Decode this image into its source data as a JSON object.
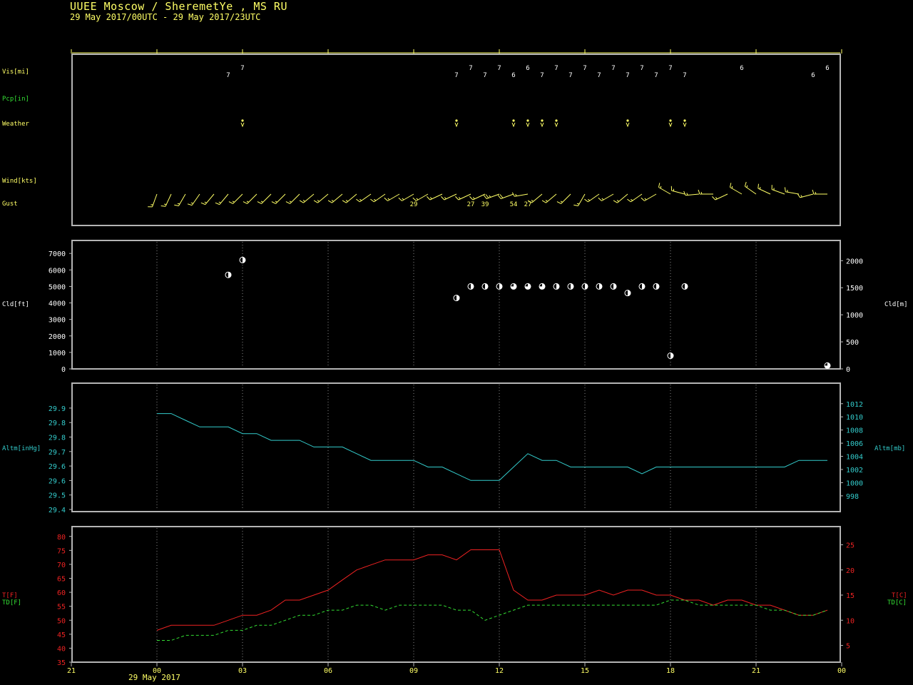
{
  "header": {
    "station": "UUEE  Moscow / SheremetYe , MS RU",
    "period": "29 May 2017/00UTC - 29 May 2017/23UTC"
  },
  "colors": {
    "frame": "#b4b4b4",
    "grid": "#8a8a8a",
    "yellow": "#ffff66",
    "green": "#33dd33",
    "cyan": "#33cccc",
    "red": "#ee2222",
    "white": "#ffffff"
  },
  "panel1": {
    "row_labels": {
      "vis": "Vis[mi]",
      "pcp": "Pcp[in]",
      "weather": "Weather",
      "wind": "Wind[kts]",
      "gust": "Gust"
    },
    "weather_icon": "drizzle-icon"
  },
  "panel2": {
    "left_label": "Cld[ft]",
    "right_label": "Cld[m]"
  },
  "panel3": {
    "left_label": "Altm[inHg]",
    "right_label": "Altm[mb]"
  },
  "panel4": {
    "left_label_t": "T[F]",
    "left_label_td": "TD[F]",
    "right_label_t": "T[C]",
    "right_label_td": "TD[C]"
  },
  "time_axis": {
    "date_label": "29 May 2017",
    "ticks": [
      "21",
      "00",
      "03",
      "06",
      "09",
      "12",
      "15",
      "18",
      "21",
      "00"
    ]
  },
  "chart_data": [
    {
      "type": "table",
      "name": "Vis[mi]",
      "x": [
        2.5,
        3.0,
        10.5,
        11.0,
        11.5,
        12.0,
        12.5,
        13.0,
        13.5,
        14.0,
        14.5,
        15.0,
        15.5,
        16.0,
        16.5,
        17.0,
        17.5,
        18.0,
        18.5,
        20.5,
        23.0,
        23.5
      ],
      "labels": [
        "7",
        "7",
        "7",
        "7",
        "7",
        "7",
        "6",
        "6",
        "7",
        "7",
        "7",
        "7",
        "7",
        "7",
        "7",
        "7",
        "7",
        "7",
        "7",
        "6",
        "6",
        "6"
      ]
    },
    {
      "type": "table",
      "name": "Weather",
      "x": [
        3.0,
        10.5,
        12.5,
        13.0,
        13.5,
        14.0,
        16.5,
        18.0,
        18.5
      ],
      "labels": [
        "drizzle",
        "drizzle",
        "drizzle",
        "drizzle",
        "drizzle",
        "drizzle",
        "drizzle",
        "drizzle",
        "drizzle"
      ]
    },
    {
      "type": "scatter",
      "name": "Wind[kts]",
      "x": [
        0.0,
        0.5,
        1.0,
        1.5,
        2.0,
        2.5,
        3.0,
        3.5,
        4.0,
        4.5,
        5.0,
        5.5,
        6.0,
        6.5,
        7.0,
        7.5,
        8.0,
        8.5,
        9.0,
        9.5,
        10.0,
        10.5,
        11.0,
        11.5,
        12.0,
        12.5,
        13.0,
        13.5,
        14.0,
        14.5,
        15.0,
        15.5,
        16.0,
        16.5,
        17.0,
        17.5,
        18.0,
        18.5,
        19.0,
        19.5,
        20.0,
        20.5,
        21.0,
        21.5,
        22.0,
        22.5,
        23.0,
        23.5
      ],
      "dir_deg": [
        200,
        205,
        210,
        215,
        220,
        220,
        225,
        225,
        225,
        225,
        225,
        230,
        230,
        230,
        230,
        235,
        235,
        240,
        240,
        240,
        245,
        245,
        245,
        245,
        250,
        250,
        260,
        230,
        230,
        225,
        210,
        235,
        240,
        230,
        235,
        240,
        300,
        285,
        265,
        270,
        245,
        300,
        305,
        295,
        290,
        280,
        255,
        270
      ],
      "speed_kts": [
        15,
        15,
        15,
        15,
        15,
        15,
        15,
        15,
        15,
        15,
        15,
        15,
        15,
        15,
        15,
        15,
        15,
        15,
        15,
        15,
        15,
        15,
        15,
        15,
        25,
        20,
        15,
        15,
        15,
        15,
        15,
        15,
        15,
        15,
        15,
        15,
        15,
        15,
        15,
        15,
        15,
        15,
        15,
        15,
        15,
        15,
        15,
        15
      ]
    },
    {
      "type": "table",
      "name": "Gust",
      "x": [
        9.0,
        11.0,
        11.5,
        12.5,
        13.0
      ],
      "labels": [
        "29",
        "27",
        "39",
        "54",
        "27"
      ]
    },
    {
      "type": "scatter",
      "title": "",
      "ylabel": "Cld[ft]",
      "ylabel_right": "Cld[m]",
      "ylim": [
        0,
        7700
      ],
      "yticks": [
        0,
        1000,
        2000,
        3000,
        4000,
        5000,
        6000,
        7000
      ],
      "yticks_right": [
        0,
        500,
        1000,
        1500,
        2000
      ],
      "x": [
        2.5,
        3.0,
        10.5,
        11.0,
        11.5,
        12.0,
        12.5,
        13.0,
        13.5,
        14.0,
        14.5,
        15.0,
        15.5,
        16.0,
        16.5,
        17.0,
        17.5,
        18.0,
        18.5,
        23.5
      ],
      "y": [
        5700,
        6600,
        4300,
        5000,
        5000,
        5000,
        5000,
        5000,
        5000,
        5000,
        5000,
        5000,
        5000,
        5000,
        4600,
        5000,
        5000,
        800,
        5000,
        200
      ],
      "cover": [
        "sct",
        "sct",
        "sct",
        "sct",
        "sct",
        "sct",
        "bkn",
        "bkn",
        "bkn",
        "sct",
        "sct",
        "sct",
        "sct",
        "sct",
        "sct",
        "sct",
        "sct",
        "sct",
        "sct",
        "bkn"
      ]
    },
    {
      "type": "line",
      "ylabel": "Altm[inHg]",
      "ylabel_right": "Altm[mb]",
      "ylim": [
        29.4,
        29.97
      ],
      "yticks": [
        29.4,
        29.5,
        29.6,
        29.6,
        29.7,
        29.8,
        29.8,
        29.9
      ],
      "yticks_right": [
        998,
        1000,
        1002,
        1004,
        1006,
        1008,
        1010,
        1012
      ],
      "x": [
        0.0,
        0.5,
        1.0,
        1.5,
        2.0,
        2.5,
        3.0,
        3.5,
        4.0,
        4.5,
        5.0,
        5.5,
        6.0,
        6.5,
        7.0,
        7.5,
        8.0,
        8.5,
        9.0,
        9.5,
        10.0,
        10.5,
        11.0,
        11.5,
        12.0,
        12.5,
        13.0,
        13.5,
        14.0,
        14.5,
        15.0,
        15.5,
        16.0,
        16.5,
        17.0,
        17.5,
        18.0,
        18.5,
        19.0,
        19.5,
        20.0,
        20.5,
        21.0,
        21.5,
        22.0,
        22.5,
        23.0,
        23.5
      ],
      "y": [
        29.84,
        29.84,
        29.81,
        29.78,
        29.78,
        29.78,
        29.75,
        29.75,
        29.72,
        29.72,
        29.72,
        29.69,
        29.69,
        29.69,
        29.66,
        29.63,
        29.63,
        29.63,
        29.63,
        29.6,
        29.6,
        29.57,
        29.54,
        29.54,
        29.54,
        29.6,
        29.66,
        29.63,
        29.63,
        29.6,
        29.6,
        29.6,
        29.6,
        29.6,
        29.57,
        29.6,
        29.6,
        29.6,
        29.6,
        29.6,
        29.6,
        29.6,
        29.6,
        29.6,
        29.6,
        29.63,
        29.63,
        29.63
      ]
    },
    {
      "type": "line",
      "ylabel": "T[F]",
      "ylabel_right": "T[C]",
      "ylim": [
        35,
        83
      ],
      "yticks": [
        35,
        40,
        45,
        50,
        55,
        60,
        65,
        70,
        75,
        80
      ],
      "yticks_right": [
        5,
        10,
        15,
        20,
        25
      ],
      "x": [
        0.0,
        0.5,
        1.0,
        1.5,
        2.0,
        2.5,
        3.0,
        3.5,
        4.0,
        4.5,
        5.0,
        5.5,
        6.0,
        6.5,
        7.0,
        7.5,
        8.0,
        8.5,
        9.0,
        9.5,
        10.0,
        10.5,
        11.0,
        11.5,
        12.0,
        12.5,
        13.0,
        13.5,
        14.0,
        14.5,
        15.0,
        15.5,
        16.0,
        16.5,
        17.0,
        17.5,
        18.0,
        18.5,
        19.0,
        19.5,
        20.0,
        20.5,
        21.0,
        21.5,
        22.0,
        22.5,
        23.0,
        23.5
      ],
      "series": [
        {
          "name": "T[F]",
          "values": [
            46.4,
            48.2,
            48.2,
            48.2,
            48.2,
            50.0,
            51.8,
            51.8,
            53.6,
            57.2,
            57.2,
            59.0,
            60.8,
            64.4,
            68.0,
            69.8,
            71.6,
            71.6,
            71.6,
            73.4,
            73.4,
            71.6,
            75.2,
            75.2,
            75.2,
            60.8,
            57.2,
            57.2,
            59.0,
            59.0,
            59.0,
            60.8,
            59.0,
            60.8,
            60.8,
            59.0,
            59.0,
            57.2,
            57.2,
            55.4,
            57.2,
            57.2,
            55.4,
            55.4,
            53.6,
            51.8,
            51.8,
            53.6
          ]
        },
        {
          "name": "TD[F]",
          "values": [
            42.8,
            42.8,
            44.6,
            44.6,
            44.6,
            46.4,
            46.4,
            48.2,
            48.2,
            50.0,
            51.8,
            51.8,
            53.6,
            53.6,
            55.4,
            55.4,
            53.6,
            55.4,
            55.4,
            55.4,
            55.4,
            53.6,
            53.6,
            50.0,
            51.8,
            53.6,
            55.4,
            55.4,
            55.4,
            55.4,
            55.4,
            55.4,
            55.4,
            55.4,
            55.4,
            55.4,
            57.2,
            57.2,
            55.4,
            55.4,
            55.4,
            55.4,
            55.4,
            53.6,
            53.6,
            51.8,
            51.8,
            53.6
          ]
        }
      ]
    }
  ]
}
